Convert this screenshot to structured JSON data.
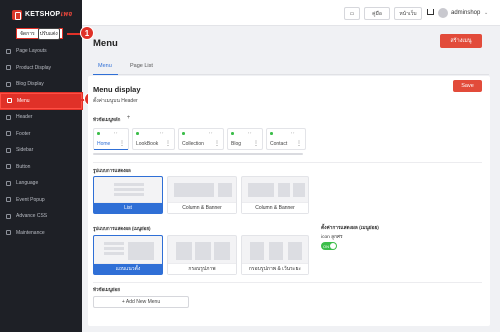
{
  "sidebar": {
    "logo_text": "KETSHOP",
    "logo_accent": "เพจ",
    "mode_toggle": [
      "จัดการ",
      "ปรับแต่ง"
    ],
    "items": [
      {
        "label": "Page Layouts",
        "icon": "layout-icon"
      },
      {
        "label": "Product Display",
        "icon": "product-icon"
      },
      {
        "label": "Blog Display",
        "icon": "blog-icon"
      },
      {
        "label": "Menu",
        "icon": "menu-icon",
        "active": true
      },
      {
        "label": "Header",
        "icon": "header-icon"
      },
      {
        "label": "Footer",
        "icon": "footer-icon"
      },
      {
        "label": "Sidebar",
        "icon": "sidebar-icon"
      },
      {
        "label": "Button",
        "icon": "button-icon"
      },
      {
        "label": "Language",
        "icon": "language-icon"
      },
      {
        "label": "Event Popup",
        "icon": "popup-icon"
      },
      {
        "label": "Advance CSS",
        "icon": "css-icon"
      },
      {
        "label": "Maintenance",
        "icon": "maintenance-icon"
      }
    ]
  },
  "callouts": {
    "one": "1",
    "two": "2"
  },
  "topbar": {
    "btn_screen": "▭",
    "btn_guide": "คู่มือ",
    "btn_storefront": "หน้าเว็บ",
    "username": "adminshop",
    "caret": "⌄"
  },
  "page": {
    "title": "Menu",
    "create_button": "สร้างเมนู",
    "tabs": [
      "Menu",
      "Page List"
    ]
  },
  "menu_card": {
    "title": "Menu display",
    "subtitle": "ตั้งค่าเมนูบน Header",
    "save_button": "Save",
    "main_menu_label": "หัวข้อเมนูหลัก",
    "menu_items": [
      "Home",
      "LookBook",
      "Collection",
      "Blog",
      "Contact"
    ],
    "display_format_label": "รูปแบบการแสดงผล",
    "display_options": [
      "List",
      "Column & Banner",
      "Column & Banner"
    ],
    "submenu_format_label": "รูปแบบการแสดงผล (เมนูย่อย)",
    "submenu_options": [
      "แถบแนวตั้ง",
      "กรอบรูปภาพ",
      "กรอบรูปภาพ & เว้นระยะ"
    ],
    "submenu_display_label": "ตั้งค่าการแสดงผล (เมนูย่อย)",
    "icon_label": "icon ลูกศร",
    "toggle_text": "ON",
    "submenu_label": "หัวข้อเมนูย่อย",
    "add_menu_button": "+ Add New Menu"
  },
  "colors": {
    "accent": "#e03128",
    "primary": "#2f6fd6",
    "sidebar_bg": "#1e2026",
    "success": "#3cbe4a"
  }
}
